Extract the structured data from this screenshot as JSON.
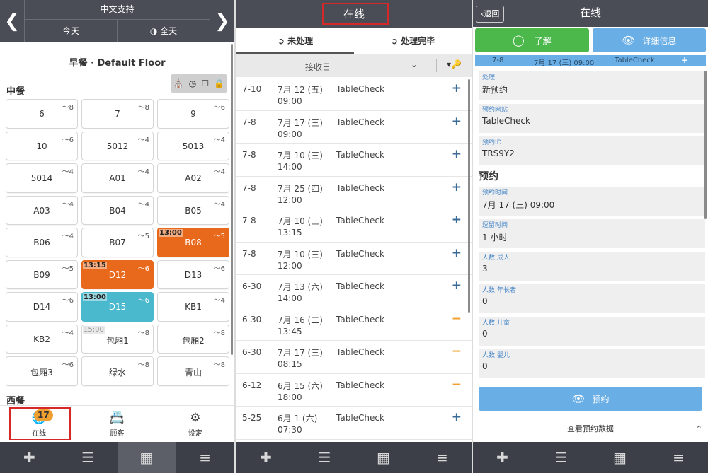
{
  "panel1": {
    "header": {
      "language": "中文支持",
      "today": "今天",
      "all": "全天",
      "prev_icon": "chevron-left-icon",
      "next_icon": "chevron-right-icon"
    },
    "floor_title": "早餐 · Default Floor",
    "section1_title": "中餐",
    "section2_title": "西餐",
    "filter_icons": [
      "table-icon",
      "clock-icon",
      "checkbox-icon",
      "lock-icon"
    ],
    "tables": [
      {
        "name": "6",
        "cap": "～8"
      },
      {
        "name": "7",
        "cap": "～8"
      },
      {
        "name": "9",
        "cap": "～6"
      },
      {
        "name": "10",
        "cap": "～6"
      },
      {
        "name": "5012",
        "cap": "～4"
      },
      {
        "name": "5013",
        "cap": "～4"
      },
      {
        "name": "5014",
        "cap": "～4"
      },
      {
        "name": "A01",
        "cap": "～4"
      },
      {
        "name": "A02",
        "cap": "～4"
      },
      {
        "name": "A03",
        "cap": "～4"
      },
      {
        "name": "B04",
        "cap": "～4"
      },
      {
        "name": "B05",
        "cap": "～4"
      },
      {
        "name": "B06",
        "cap": "～4"
      },
      {
        "name": "B07",
        "cap": "～5"
      },
      {
        "name": "B08",
        "cap": "～5",
        "time": "13:00",
        "state": "orange"
      },
      {
        "name": "B09",
        "cap": "～5"
      },
      {
        "name": "D12",
        "cap": "～6",
        "time": "13:15",
        "state": "orange"
      },
      {
        "name": "D13",
        "cap": "～6"
      },
      {
        "name": "D14",
        "cap": "～6"
      },
      {
        "name": "D15",
        "cap": "～6",
        "time": "13:00",
        "state": "cyan"
      },
      {
        "name": "KB1",
        "cap": "～4"
      },
      {
        "name": "KB2",
        "cap": "～4"
      },
      {
        "name": "包厢1",
        "cap": "～8",
        "time": "15:00",
        "state": "ghost"
      },
      {
        "name": "包厢2",
        "cap": "～8"
      },
      {
        "name": "包厢3",
        "cap": "～6"
      },
      {
        "name": "绿水",
        "cap": "～8"
      },
      {
        "name": "青山",
        "cap": "～8"
      }
    ],
    "tabs": {
      "online": "在线",
      "online_badge": "17",
      "customers": "顾客",
      "settings": "设定"
    }
  },
  "panel2": {
    "title": "在线",
    "tab_pending": "未处理",
    "tab_done": "处理完毕",
    "column_received": "接收日",
    "rows": [
      {
        "recv": "7-10",
        "date": "7月 12 (五)",
        "time": "09:00",
        "source": "TableCheck",
        "action": "+",
        "kind": "plus"
      },
      {
        "recv": "7-8",
        "date": "7月 17 (三)",
        "time": "09:00",
        "source": "TableCheck",
        "action": "+",
        "kind": "plus"
      },
      {
        "recv": "7-8",
        "date": "7月 10 (三)",
        "time": "14:00",
        "source": "TableCheck",
        "action": "+",
        "kind": "plus"
      },
      {
        "recv": "7-8",
        "date": "7月 25 (四)",
        "time": "12:00",
        "source": "TableCheck",
        "action": "+",
        "kind": "plus"
      },
      {
        "recv": "7-8",
        "date": "7月 10 (三)",
        "time": "13:15",
        "source": "TableCheck",
        "action": "+",
        "kind": "plus"
      },
      {
        "recv": "7-8",
        "date": "7月 10 (三)",
        "time": "12:00",
        "source": "TableCheck",
        "action": "+",
        "kind": "plus"
      },
      {
        "recv": "6-30",
        "date": "7月 13 (六)",
        "time": "14:00",
        "source": "TableCheck",
        "action": "+",
        "kind": "plus"
      },
      {
        "recv": "6-30",
        "date": "7月 16 (二)",
        "time": "13:45",
        "source": "TableCheck",
        "action": "−",
        "kind": "minus"
      },
      {
        "recv": "6-30",
        "date": "7月 17 (三)",
        "time": "08:15",
        "source": "TableCheck",
        "action": "−",
        "kind": "minus"
      },
      {
        "recv": "6-12",
        "date": "6月 15 (六)",
        "time": "18:00",
        "source": "TableCheck",
        "action": "−",
        "kind": "minus"
      },
      {
        "recv": "5-25",
        "date": "6月 1 (六)",
        "time": "07:30",
        "source": "TableCheck",
        "action": "+",
        "kind": "plus"
      }
    ]
  },
  "panel3": {
    "back": "退回",
    "title": "在线",
    "btn_ack": "了解",
    "btn_details": "详细信息",
    "info_recv": "7-8",
    "info_date": "7月 17 (三) 09:00",
    "info_source": "TableCheck",
    "info_action": "+",
    "fields_top": [
      {
        "label": "处理",
        "value": "新预约"
      },
      {
        "label": "预约网站",
        "value": "TableCheck"
      },
      {
        "label": "预约ID",
        "value": "TRS9Y2"
      }
    ],
    "section_title": "预约",
    "fields_bottom": [
      {
        "label": "预约时间",
        "value": "7月 17 (三) 09:00"
      },
      {
        "label": "逗留时间",
        "value": "1 小时"
      },
      {
        "label": "人数:成人",
        "value": "3"
      },
      {
        "label": "人数:年长者",
        "value": "0"
      },
      {
        "label": "人数:儿童",
        "value": "0"
      },
      {
        "label": "人数:婴儿",
        "value": "0"
      }
    ],
    "reserve_button": "预约",
    "view_data": "查看预约数据"
  },
  "bottom_bar_icons": [
    "plus-icon",
    "list-icon",
    "grid-icon",
    "menu-icon"
  ],
  "colors": {
    "header_bg": "#4a4d55",
    "orange": "#e8691c",
    "cyan": "#4ab8cd",
    "green": "#4cb84c",
    "blue": "#6aaee6",
    "badge": "#f0a030",
    "highlight": "#d62828"
  }
}
